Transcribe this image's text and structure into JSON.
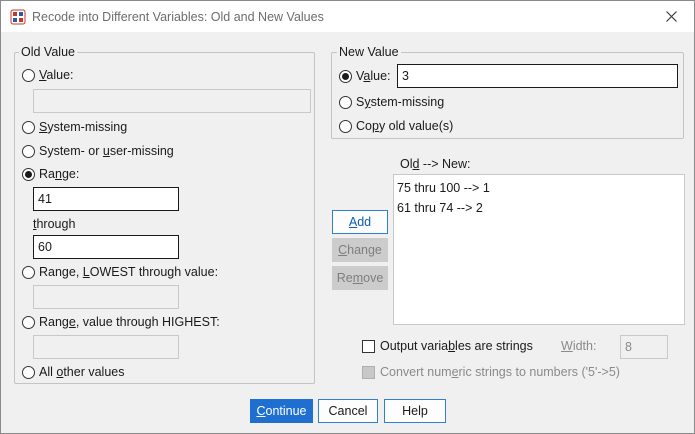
{
  "window": {
    "title": "Recode into Different Variables: Old and New Values",
    "app_icon": "spss-recode-icon",
    "close_icon": "close-icon"
  },
  "old_value": {
    "group_label": "Old Value",
    "value_label_pre": "",
    "value_label_ul": "V",
    "value_label_post": "alue:",
    "value_input": "",
    "system_missing_pre": "",
    "system_missing_ul": "S",
    "system_missing_post": "ystem-missing",
    "sys_user_missing_pre": "System- or ",
    "sys_user_missing_ul": "u",
    "sys_user_missing_post": "ser-missing",
    "range_pre": "Ra",
    "range_ul": "n",
    "range_post": "ge:",
    "range_from": "41",
    "through_pre": "",
    "through_ul": "t",
    "through_post": "hrough",
    "range_to": "60",
    "range_lowest_pre": "Range, ",
    "range_lowest_ul": "L",
    "range_lowest_post": "OWEST through value:",
    "range_lowest_input": "",
    "range_highest_pre": "Rang",
    "range_highest_ul": "e",
    "range_highest_post": ", value through HIGHEST:",
    "range_highest_input": "",
    "all_other_pre": "All ",
    "all_other_ul": "o",
    "all_other_post": "ther values",
    "selected": "range"
  },
  "new_value": {
    "group_label": "New Value",
    "value_label_pre": "V",
    "value_label_ul": "a",
    "value_label_post": "lue:",
    "value_input": "3",
    "system_missing_pre": "S",
    "system_missing_ul": "y",
    "system_missing_post": "stem-missing",
    "copy_old_pre": "Co",
    "copy_old_ul": "p",
    "copy_old_post": "y old value(s)",
    "selected": "value"
  },
  "mapping": {
    "label_pre": "Ol",
    "label_ul": "d",
    "label_post": " --> New:",
    "items": [
      "75 thru 100 --> 1",
      "61 thru 74 --> 2"
    ]
  },
  "side_buttons": {
    "add_pre": "",
    "add_ul": "A",
    "add_post": "dd",
    "change_pre": "",
    "change_ul": "C",
    "change_post": "hange",
    "remove_pre": "Re",
    "remove_ul": "m",
    "remove_post": "ove"
  },
  "options": {
    "output_strings_pre": "Output varia",
    "output_strings_ul": "b",
    "output_strings_post": "les are strings",
    "width_pre": "",
    "width_ul": "W",
    "width_post": "idth:",
    "width_value": "8",
    "convert_pre": "Convert num",
    "convert_ul": "e",
    "convert_post": "ric strings to numbers ('5'->5)"
  },
  "footer": {
    "continue_pre": "",
    "continue_ul": "C",
    "continue_post": "ontinue",
    "cancel": "Cancel",
    "help": "Help"
  },
  "colors": {
    "accent": "#1f6fd1",
    "dialog_bg": "#f0f0f0",
    "disabled_button": "#cccccc"
  }
}
